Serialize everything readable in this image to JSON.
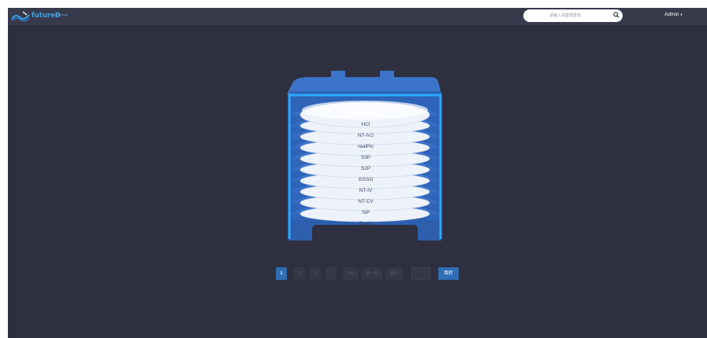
{
  "app": {
    "brand_title": "futureD",
    "brand_subtitle": "Beta Basis"
  },
  "header": {
    "search_placeholder": "请输入关键词查找",
    "user_label": "Admin",
    "user_caret": "▼"
  },
  "disks": [
    "HCI",
    "NT-IV2",
    "realPic",
    "S3P",
    "S2P",
    "GSSG",
    "NT-IV",
    "NT-CV",
    "SiP",
    "Grade"
  ],
  "pagination": {
    "items": [
      "1",
      "2",
      "3",
      "...",
      "4/1",
      "第一页",
      "尾页"
    ],
    "active_index": 0,
    "jump_label": "跳转"
  },
  "colors": {
    "background": "#2e3040",
    "topbar": "#373a4b",
    "accent": "#2f6db5",
    "frame": "#2aa8ff"
  }
}
